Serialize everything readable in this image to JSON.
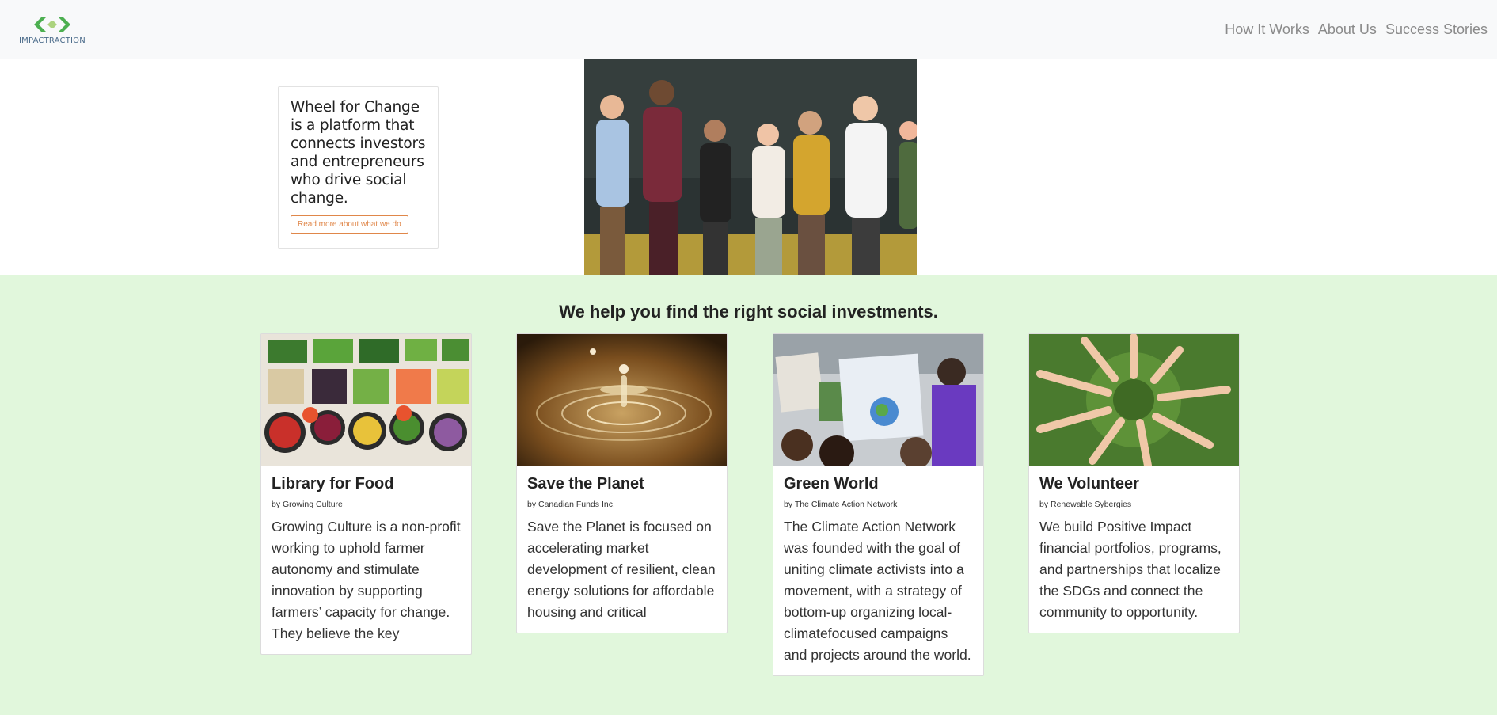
{
  "nav": {
    "brand": "IMPACTRACTION",
    "links": [
      "How It Works",
      "About Us",
      "Success Stories"
    ]
  },
  "hero": {
    "about_text": "Wheel for Change is a platform that connects investors and entrepreneurs who drive social change.",
    "about_button": "Read more about what we do"
  },
  "section": {
    "title": "We help you find the right social investments."
  },
  "cards": [
    {
      "title": "Library for Food",
      "org": "by Growing Culture",
      "description": "Growing Culture is a non-profit working to uphold farmer autonomy and stimulate innovation by supporting farmers’ capacity for change. They believe the key"
    },
    {
      "title": "Save the Planet",
      "org": "by Canadian Funds Inc.",
      "description": "Save the Planet is focused on accelerating market development of resilient, clean energy solutions for affordable housing and critical"
    },
    {
      "title": "Green World",
      "org": "by The Climate Action Network",
      "description": "The Climate Action Network was founded with the goal of uniting climate activists into a movement, with a strategy of bottom-up organizing local-climatefocused campaigns and projects around the world."
    },
    {
      "title": "We Volunteer",
      "org": "by Renewable Sybergies",
      "description": "We build Positive Impact financial portfolios, programs, and partnerships that localize the SDGs and connect the community to opportunity."
    }
  ],
  "colors": {
    "section_bg": "#e1f7dc",
    "accent_orange": "#e0874a",
    "logo_green": "#4caf50",
    "nav_bg": "#f8f9fa"
  }
}
